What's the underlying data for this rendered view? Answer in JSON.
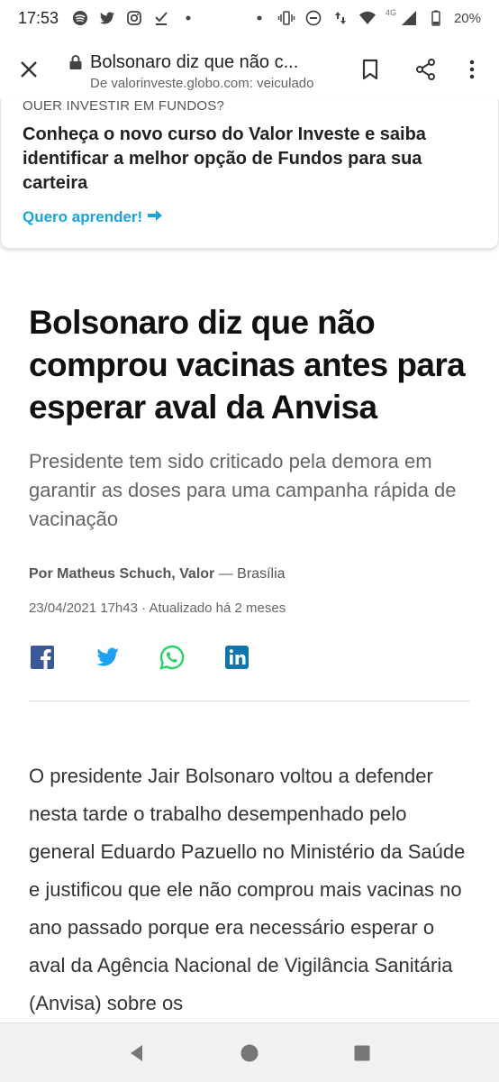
{
  "status_bar": {
    "time": "17:53",
    "left_icons": [
      "spotify-icon",
      "twitter-icon",
      "instagram-icon",
      "check-done-icon",
      "dot-icon"
    ],
    "right_icons": [
      "dot-icon",
      "vibrate-icon",
      "do-not-disturb-icon",
      "data-arrows-icon",
      "wifi-icon",
      "signal-icon",
      "battery-icon"
    ],
    "network_label": "4G",
    "battery": "20%"
  },
  "toolbar": {
    "title": "Bolsonaro diz que não c...",
    "url": "De valorinveste.globo.com: veiculado"
  },
  "promo": {
    "kicker": "QUER INVESTIR EM FUNDOS?",
    "text": "Conheça o novo curso do Valor Investe e saiba identificar a melhor opção de Fundos para sua carteira",
    "link": "Quero aprender!",
    "accent_color": "#1aa3dd"
  },
  "article": {
    "headline": "Bolsonaro diz que não comprou vacinas antes para esperar aval da Anvisa",
    "subhead": "Presidente tem sido criticado pela demora em garantir as doses para uma campanha rápida de vacinação",
    "byline_author": "Por Matheus Schuch, Valor",
    "byline_location": " — Brasília",
    "date": "23/04/2021 17h43 · Atualizado há 2 meses",
    "body": "O presidente Jair Bolsonaro voltou a defender nesta tarde o trabalho desempenhado pelo general Eduardo Pazuello no Ministério da Saúde e justificou que ele não comprou mais vacinas no ano passado porque era necessário esperar o aval da Agência Nacional de Vigilância Sanitária (Anvisa) sobre os"
  },
  "share": {
    "icons": [
      "facebook-icon",
      "twitter-icon",
      "whatsapp-icon",
      "linkedin-icon"
    ],
    "colors": {
      "facebook": "#3b5998",
      "twitter": "#1da1f2",
      "whatsapp": "#25d366",
      "linkedin": "#0e76a8"
    }
  },
  "navbar": {
    "icons": [
      "back-triangle-icon",
      "home-circle-icon",
      "recents-square-icon"
    ]
  }
}
